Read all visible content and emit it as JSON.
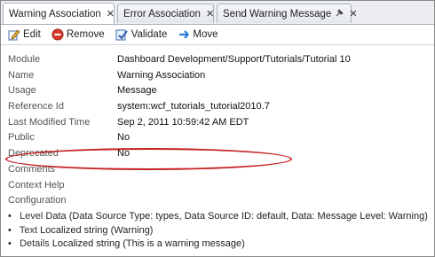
{
  "tabs": [
    {
      "label": "Warning Association",
      "close": "✕"
    },
    {
      "label": "Error Association",
      "close": "✕"
    },
    {
      "label": "Send Warning Message",
      "close": "✕"
    }
  ],
  "toolbar": {
    "edit": "Edit",
    "remove": "Remove",
    "validate": "Validate",
    "move": "Move"
  },
  "properties": [
    {
      "key": "Module",
      "value": "Dashboard Development/Support/Tutorials/Tutorial 10"
    },
    {
      "key": "Name",
      "value": "Warning Association"
    },
    {
      "key": "Usage",
      "value": "Message"
    },
    {
      "key": "Reference Id",
      "value": "system:wcf_tutorials_tutorial2010.7"
    },
    {
      "key": "Last Modified Time",
      "value": "Sep 2, 2011 10:59:42 AM EDT"
    },
    {
      "key": "Public",
      "value": "No"
    },
    {
      "key": "Deprecated",
      "value": "No"
    },
    {
      "key": "Comments",
      "value": ""
    },
    {
      "key": "Context Help",
      "value": ""
    },
    {
      "key": "Configuration",
      "value": ""
    }
  ],
  "configuration": [
    {
      "key": "Level",
      "value": "Data (Data Source Type: types, Data Source ID: default, Data: Message Level: Warning)"
    },
    {
      "key": "Text",
      "value": "Localized string (Warning)"
    },
    {
      "key": "Details",
      "value": "Localized string (This is a warning message)"
    }
  ],
  "colors": {
    "highlight_ring": "#c62020",
    "tab_border": "#a9b1bd"
  }
}
